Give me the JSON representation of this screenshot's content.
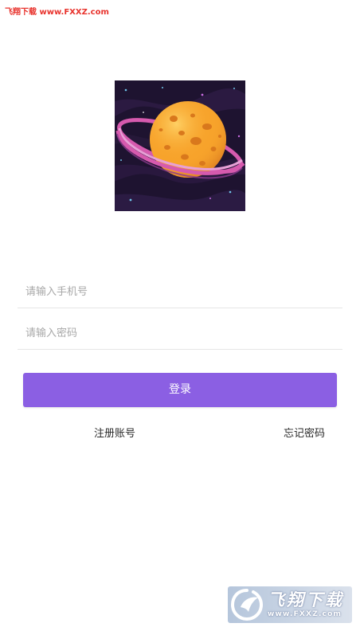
{
  "watermark": {
    "top_text": "飞翔下载 www.FXXZ.com",
    "corner_title": "飞翔下载",
    "corner_url": "www.FXXZ.com"
  },
  "logo": {
    "icon": "planet-logo-icon",
    "colors": {
      "background": "#1e1330",
      "planet": "#f7a32b",
      "ring": "#e066b8"
    }
  },
  "form": {
    "phone_placeholder": "请输入手机号",
    "phone_value": "",
    "password_placeholder": "请输入密码",
    "password_value": ""
  },
  "actions": {
    "login_label": "登录",
    "register_label": "注册账号",
    "forgot_label": "忘记密码"
  },
  "theme": {
    "accent": "#8b5fe3"
  }
}
